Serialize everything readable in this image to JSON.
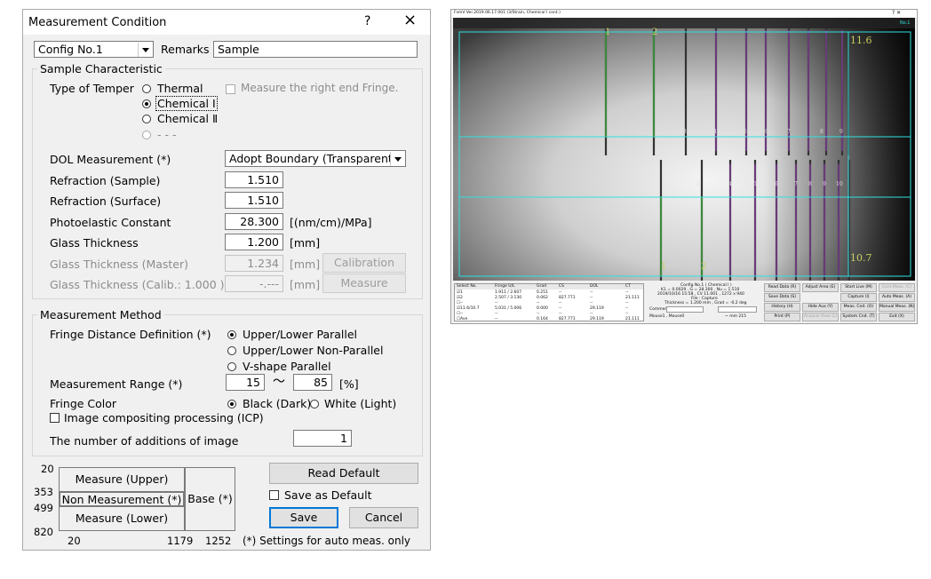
{
  "dialog": {
    "title": "Measurement Condition",
    "help_glyph": "?",
    "close_glyph": "×",
    "config_select": "Config No.1",
    "remarks_label": "Remarks",
    "remarks_value": "Sample",
    "sample_group": "Sample Characteristic",
    "temper_label": "Type of Temper",
    "temper_options": [
      "Thermal",
      "Chemical Ⅰ",
      "Chemical Ⅱ",
      "- - -"
    ],
    "temper_selected": "Chemical Ⅰ",
    "right_end_label": "Measure the right end Fringe.",
    "dol_label": "DOL Measurement (*)",
    "dol_value": "Adopt Boundary (Transparent)",
    "refr_sample_label": "Refraction (Sample)",
    "refr_sample_value": "1.510",
    "refr_surface_label": "Refraction (Surface)",
    "refr_surface_value": "1.510",
    "photo_label": "Photoelastic Constant",
    "photo_value": "28.300",
    "photo_unit": "[(nm/cm)/MPa]",
    "thick_label": "Glass Thickness",
    "thick_value": "1.200",
    "thick_unit": "[mm]",
    "thick_master_label": "Glass Thickness (Master)",
    "thick_master_value": "1.234",
    "thick_master_unit": "[mm]",
    "calibration_btn": "Calibration",
    "thick_calib_label": "Glass Thickness (Calib.: 1.000 )",
    "thick_calib_value": "-.---",
    "thick_calib_unit": "[mm]",
    "measure_btn": "Measure",
    "method_group": "Measurement Method",
    "fringe_dist_label": "Fringe Distance Definition (*)",
    "fringe_dist_options": [
      "Upper/Lower Parallel",
      "Upper/Lower Non-Parallel",
      "V-shape Parallel"
    ],
    "fringe_dist_selected": "Upper/Lower Parallel",
    "range_label": "Measurement Range (*)",
    "range_from": "15",
    "range_tilde": "～",
    "range_to": "85",
    "range_unit": "[%]",
    "color_label": "Fringe Color",
    "color_options": [
      "Black (Dark)",
      "White (Light)"
    ],
    "color_selected": "Black (Dark)",
    "icp_label": "Image compositing processing (ICP)",
    "additions_label": "The number of additions of image",
    "additions_value": "1",
    "diagram": {
      "y_labels": [
        "20",
        "353",
        "499",
        "820"
      ],
      "x_labels": [
        "20",
        "1179",
        "1252"
      ],
      "measure_upper": "Measure (Upper)",
      "non_measure": "Non Measurement (*)",
      "measure_lower": "Measure (Lower)",
      "base": "Base (*)"
    },
    "read_default_btn": "Read Default",
    "save_default_label": "Save as Default",
    "save_btn": "Save",
    "cancel_btn": "Cancel",
    "footnote": "(*) Settings for auto meas. only"
  },
  "viewer": {
    "title": "FsmV Ver.2019.06.17.001 (3/Strain, Chemical I cont.)",
    "win_controls": "?   ✕",
    "corner_tag": "No.1",
    "upper_labels": [
      "1",
      "2",
      "3",
      "4",
      "5",
      "6",
      "7",
      "8",
      "9"
    ],
    "lower_labels": [
      "1",
      "2",
      "3",
      "4",
      "5",
      "6",
      "7",
      "8",
      "9",
      "10"
    ],
    "value_upper": "11.6",
    "value_lower": "10.7",
    "table": {
      "headers": [
        "Select No.",
        "Fringe U/L",
        "Grad",
        "CS",
        "DOL",
        "CT"
      ],
      "rows": [
        [
          "☑1",
          "1.911 / 2.607",
          "0.251",
          "--",
          "--",
          "--"
        ],
        [
          "☑2",
          "2.507 / 3.130",
          "0.062",
          "827.771",
          "--",
          "21.111"
        ],
        [
          "☐--",
          "--",
          "--",
          "--",
          "--",
          "--"
        ],
        [
          "☑11.6/10.7",
          "5.031 / 5.006",
          "0.000",
          "--",
          "29.119",
          "--"
        ],
        [
          "☐--",
          "--",
          "--",
          "--",
          "--",
          "--"
        ],
        [
          "☐Ave",
          "--",
          "0.164",
          "827.771",
          "29.119",
          "21.111"
        ]
      ]
    },
    "info_lines": [
      "Config No.1 ( Chemical I )",
      "K1 = 0.0029 , G = 28.300 , Nu = 1.510",
      "2019/10/16 15:58 , CV 11.001 , 1272 x 940",
      "File : Capture",
      "Thickness = 1.200 mm , Grad = -0.2 deg"
    ],
    "comment_label": "Comment",
    "mouse_label": "Mouse1 ,  Mouse0",
    "mm_text": "~ mm   215",
    "buttons": [
      [
        "Read Data (R)",
        "Adjust Area (E)",
        "Start Live (M)",
        "Cont Meas. (C)"
      ],
      [
        "Save Data (S)",
        "",
        "Capture (I)",
        "Auto Meas. (A)"
      ],
      [
        "History (H)",
        "Hide Aux (Y)",
        "Meas. Cnd. (O)",
        "Manual Meas. (N)"
      ],
      [
        "Print (P)",
        "Analyze View (L)",
        "System Cnd. (T)",
        "Exit (X)"
      ]
    ],
    "disabled_buttons": [
      "Cont Meas. (C)",
      "Analyze View (L)"
    ]
  }
}
